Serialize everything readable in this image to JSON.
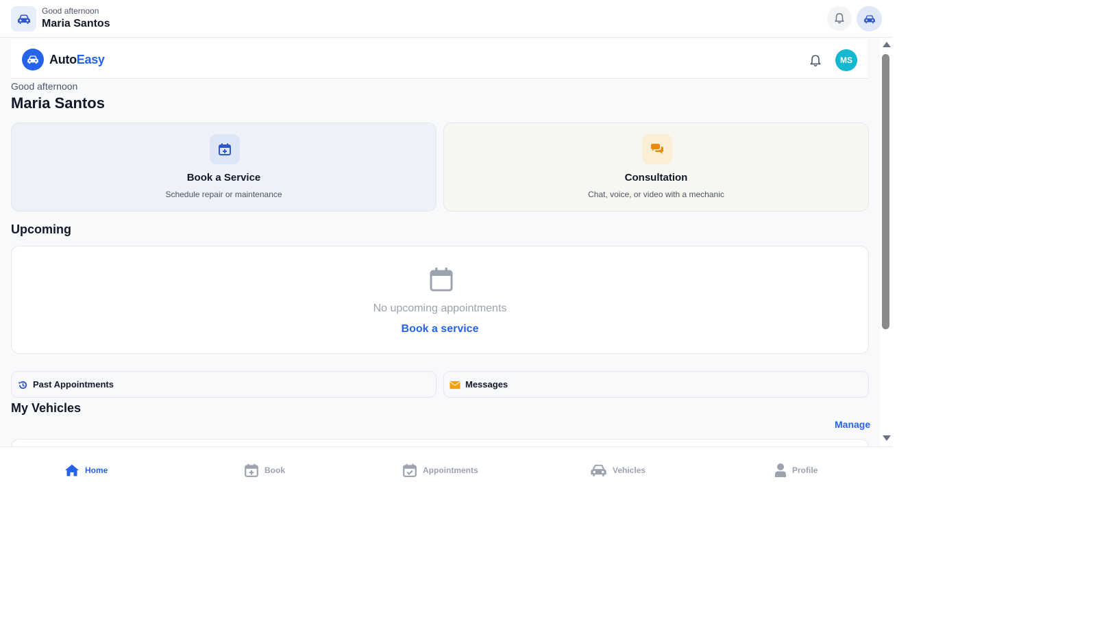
{
  "topbar": {
    "greeting": "Good afternoon",
    "user_name": "Maria Santos"
  },
  "app_header": {
    "brand_part1": "Auto",
    "brand_part2": "Easy",
    "avatar_initials": "MS"
  },
  "greeting": {
    "text": "Good afternoon",
    "name": "Maria Santos"
  },
  "actions": [
    {
      "title": "Book a Service",
      "subtitle": "Schedule repair or maintenance",
      "icon": "calendar-plus-icon"
    },
    {
      "title": "Consultation",
      "subtitle": "Chat, voice, or video with a mechanic",
      "icon": "chat-icon"
    }
  ],
  "upcoming": {
    "title": "Upcoming",
    "empty_text": "No upcoming appointments",
    "empty_link": "Book a service"
  },
  "quick_links": [
    {
      "label": "Past Appointments",
      "icon": "history-icon"
    },
    {
      "label": "Messages",
      "icon": "envelope-icon"
    }
  ],
  "vehicles": {
    "title": "My Vehicles",
    "manage_label": "Manage"
  },
  "bottom_nav": [
    {
      "label": "Home",
      "icon": "home-icon",
      "active": true
    },
    {
      "label": "Book",
      "icon": "calendar-plus-icon",
      "active": false
    },
    {
      "label": "Appointments",
      "icon": "calendar-check-icon",
      "active": false
    },
    {
      "label": "Vehicles",
      "icon": "car-icon",
      "active": false
    },
    {
      "label": "Profile",
      "icon": "user-icon",
      "active": false
    }
  ],
  "colors": {
    "primary": "#2563eb",
    "accent_orange": "#f59e0b",
    "avatar": "#14b8d1",
    "muted": "#9ca3af"
  }
}
